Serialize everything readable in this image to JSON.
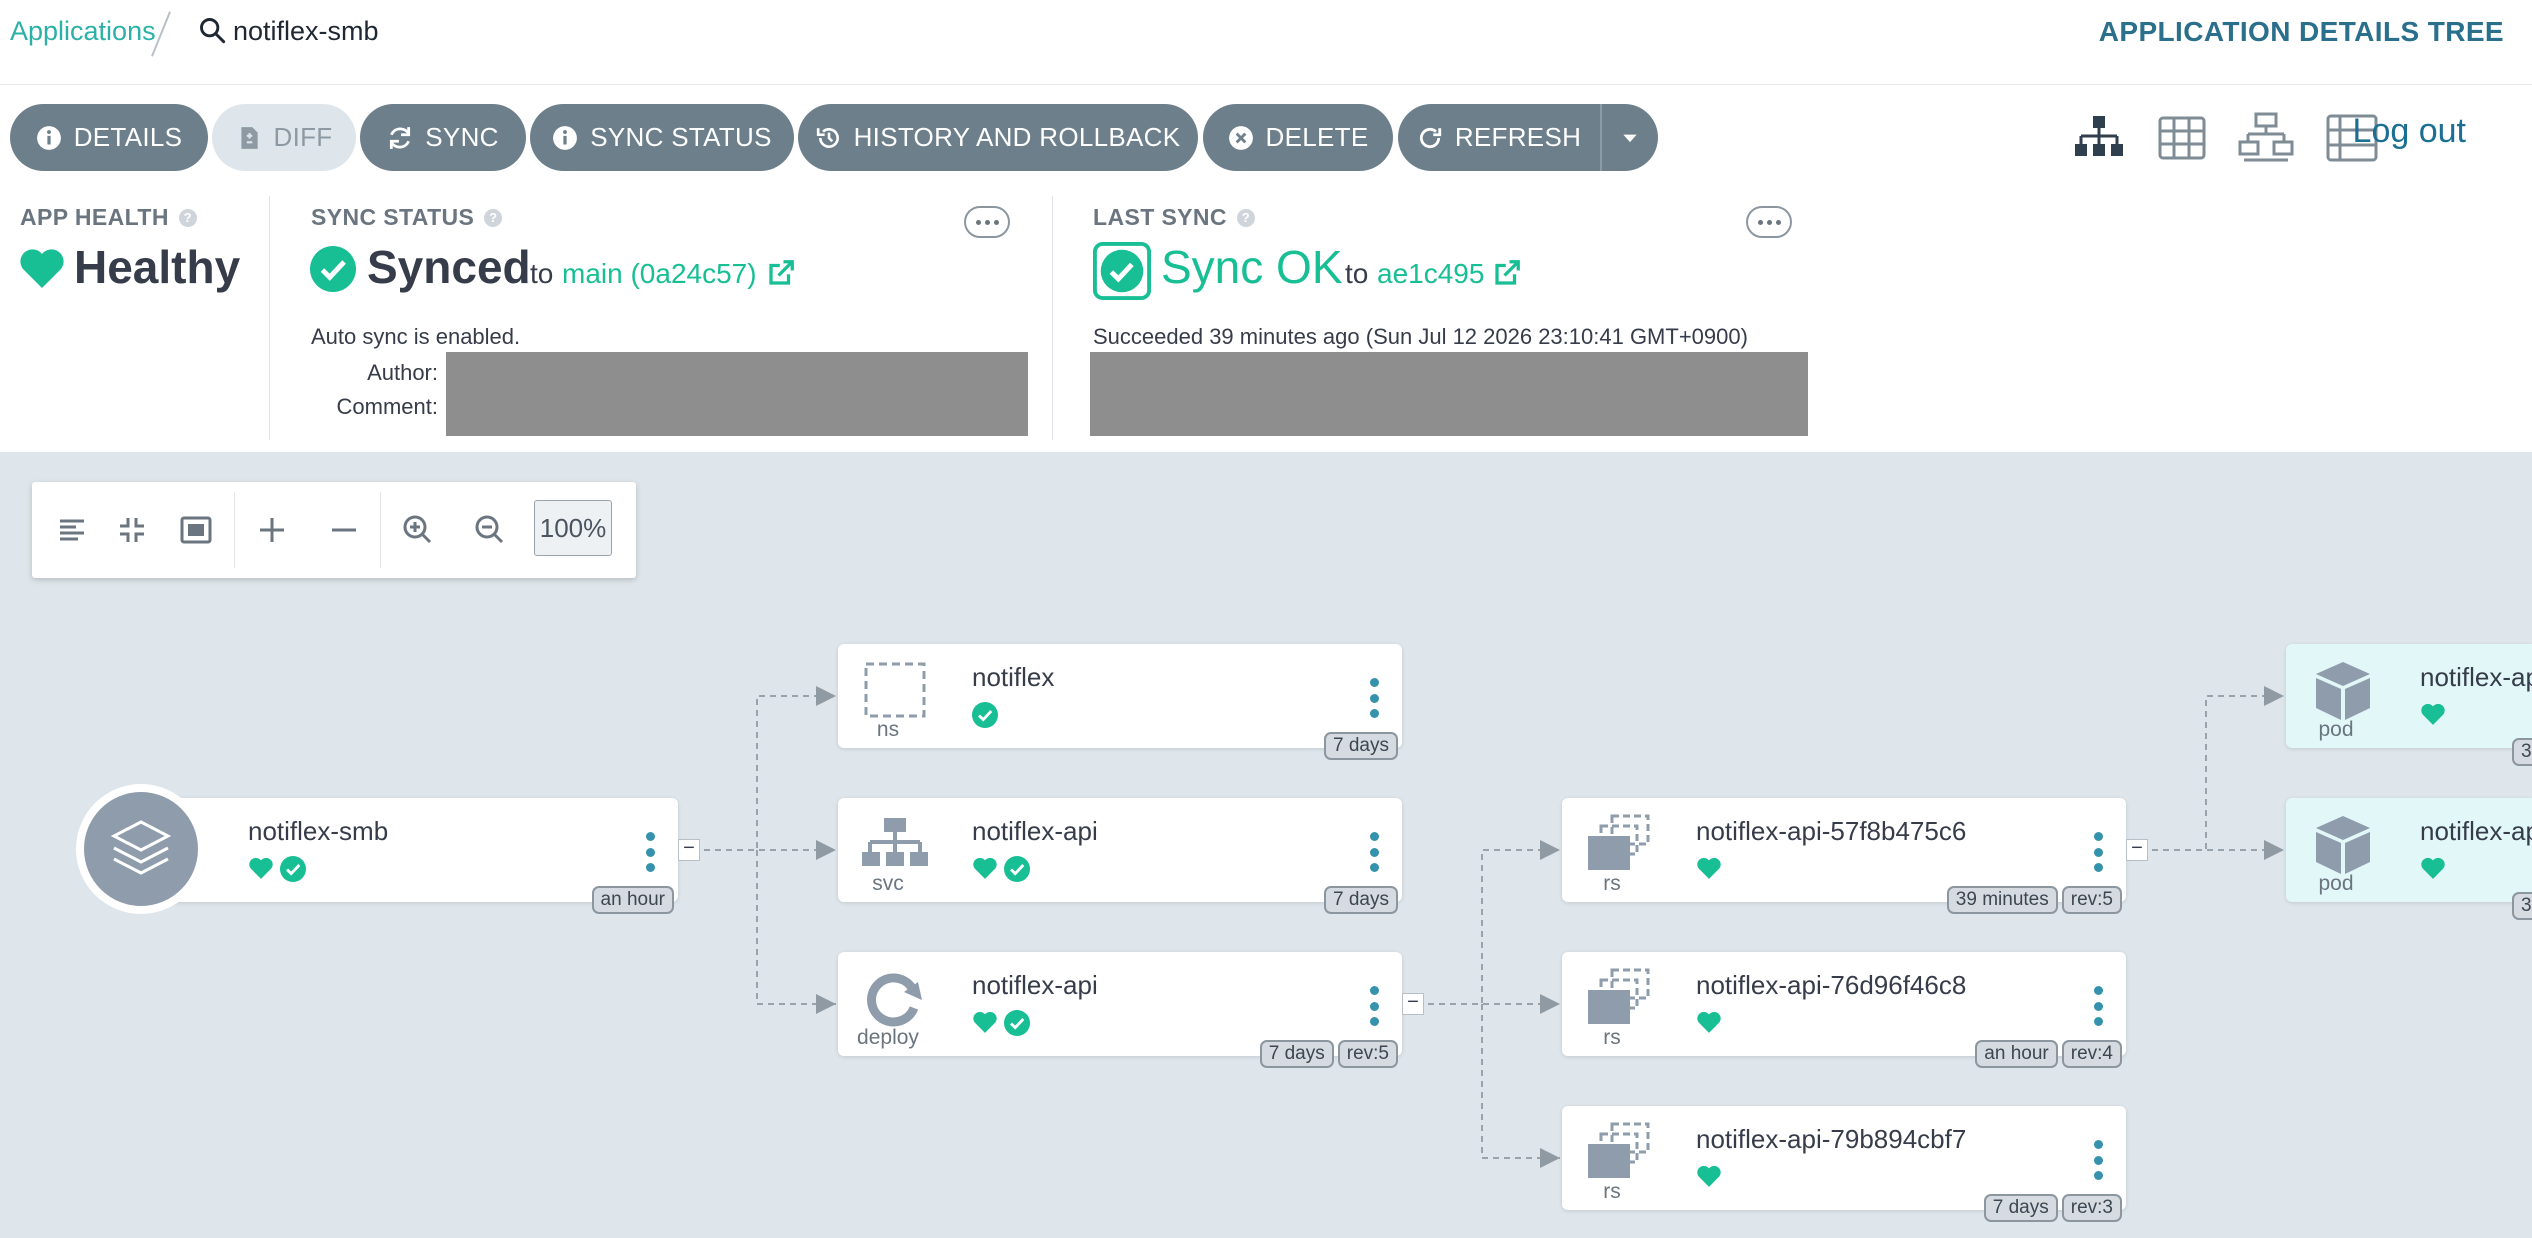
{
  "breadcrumb": {
    "applications": "Applications",
    "app_name": "notiflex-smb"
  },
  "view_title": "APPLICATION DETAILS TREE",
  "toolbar": {
    "details": "DETAILS",
    "diff": "DIFF",
    "sync": "SYNC",
    "sync_status": "SYNC STATUS",
    "history": "HISTORY AND ROLLBACK",
    "delete": "DELETE",
    "refresh": "REFRESH",
    "logout": "Log out"
  },
  "app_health": {
    "label": "APP HEALTH",
    "value": "Healthy"
  },
  "sync_status": {
    "label": "SYNC STATUS",
    "value": "Synced",
    "to": "to",
    "revision": "main (0a24c57)",
    "auto_sync": "Auto sync is enabled.",
    "author_label": "Author:",
    "comment_label": "Comment:"
  },
  "last_sync": {
    "label": "LAST SYNC",
    "value": "Sync OK",
    "to": "to",
    "revision": "ae1c495",
    "succeeded": "Succeeded 39 minutes ago (Sun Jul 12 2026 23:10:41 GMT+0900)"
  },
  "zoom": {
    "level": "100%"
  },
  "nodes": {
    "app": {
      "name": "notiflex-smb",
      "tags": [
        "an hour"
      ]
    },
    "ns": {
      "name": "notiflex",
      "kind": "ns",
      "tags": [
        "7 days"
      ]
    },
    "svc": {
      "name": "notiflex-api",
      "kind": "svc",
      "tags": [
        "7 days"
      ]
    },
    "deploy": {
      "name": "notiflex-api",
      "kind": "deploy",
      "tags": [
        "7 days",
        "rev:5"
      ]
    },
    "rs1": {
      "name": "notiflex-api-57f8b475c6",
      "kind": "rs",
      "tags": [
        "39 minutes",
        "rev:5"
      ]
    },
    "rs2": {
      "name": "notiflex-api-76d96f46c8",
      "kind": "rs",
      "tags": [
        "an hour",
        "rev:4"
      ]
    },
    "rs3": {
      "name": "notiflex-api-79b894cbf7",
      "kind": "rs",
      "tags": [
        "7 days",
        "rev:3"
      ]
    },
    "pod1": {
      "name": "notiflex-ap",
      "kind": "pod",
      "tag": "3"
    },
    "pod2": {
      "name": "notiflex-ap",
      "kind": "pod",
      "tag": "3"
    }
  },
  "colors": {
    "teal": "#2bb1a6",
    "green": "#18be94",
    "button": "#6d7f8b",
    "link": "#1a6f93",
    "canvas": "#dee6eb"
  }
}
